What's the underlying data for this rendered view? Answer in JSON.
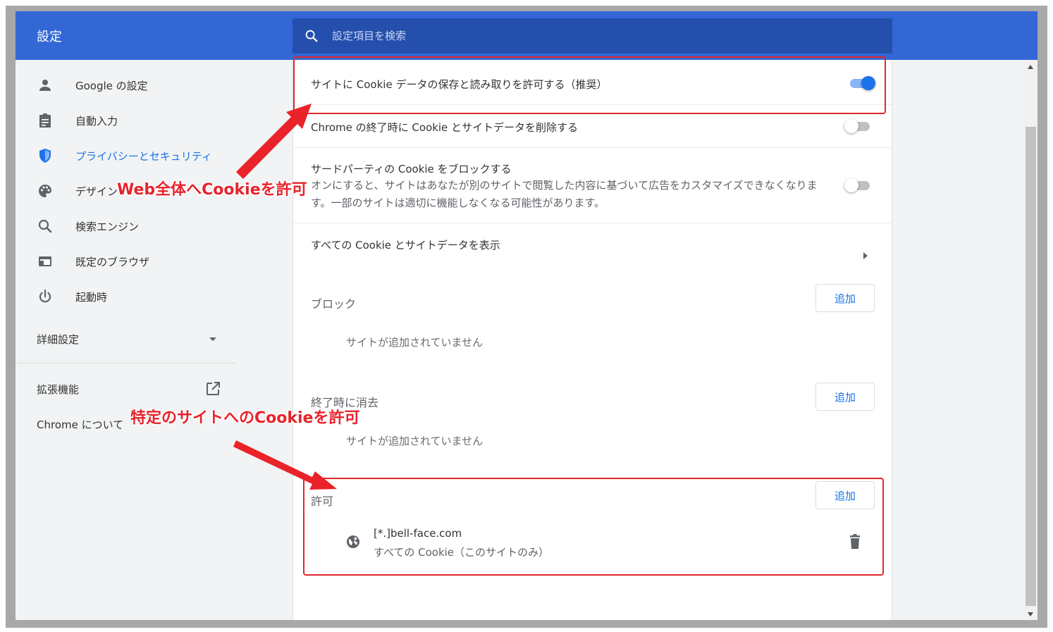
{
  "header": {
    "title": "設定",
    "search_placeholder": "設定項目を検索"
  },
  "sidebar": {
    "items": [
      {
        "label": "Google の設定",
        "icon": "person-icon"
      },
      {
        "label": "自動入力",
        "icon": "clipboard-icon"
      },
      {
        "label": "プライバシーとセキュリティ",
        "icon": "shield-icon",
        "active": true
      },
      {
        "label": "デザイン",
        "icon": "palette-icon"
      },
      {
        "label": "検索エンジン",
        "icon": "search-icon"
      },
      {
        "label": "既定のブラウザ",
        "icon": "browser-icon"
      },
      {
        "label": "起動時",
        "icon": "power-icon"
      }
    ],
    "advanced_label": "詳細設定",
    "extensions_label": "拡張機能",
    "about_label": "Chrome について"
  },
  "settings": {
    "allow_cookies_label": "サイトに Cookie データの保存と読み取りを許可する（推奨）",
    "allow_cookies_on": true,
    "clear_on_exit_label": "Chrome の終了時に Cookie とサイトデータを削除する",
    "clear_on_exit_on": false,
    "block_third_party_label": "サードパーティの Cookie をブロックする",
    "block_third_party_desc": "オンにすると、サイトはあなたが別のサイトで閲覧した内容に基づいて広告をカスタマイズできなくなります。一部のサイトは適切に機能しなくなる可能性があります。",
    "block_third_party_on": false,
    "see_all_label": "すべての Cookie とサイトデータを表示",
    "block_heading": "ブロック",
    "clear_heading": "終了時に消去",
    "allow_heading": "許可",
    "add_label": "追加",
    "empty_label": "サイトが追加されていません",
    "allowed_sites": [
      {
        "name": "[*.]bell-face.com",
        "desc": "すべての Cookie（このサイトのみ）"
      }
    ]
  },
  "annotations": {
    "global": "Web全体へCookieを許可",
    "specific": "特定のサイトへのCookieを許可",
    "color": "#e8232b"
  },
  "colors": {
    "accent": "#1a73e8",
    "topbar": "#3367d6",
    "search_bg": "#254fad"
  }
}
